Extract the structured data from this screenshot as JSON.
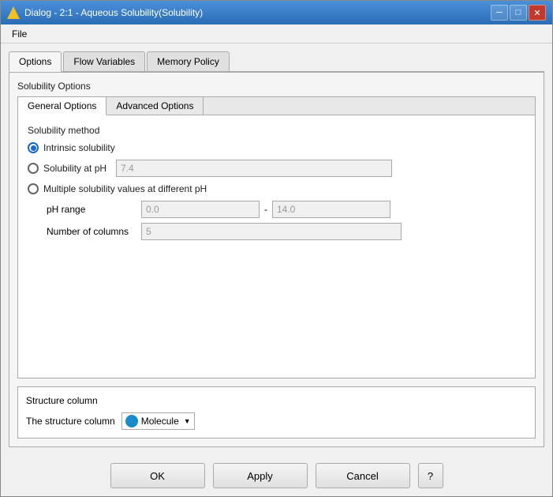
{
  "window": {
    "title": "Dialog - 2:1 - Aqueous Solubility(Solubility)",
    "icon": "warning-icon"
  },
  "title_controls": {
    "minimize": "─",
    "maximize": "□",
    "close": "✕"
  },
  "menu": {
    "file_label": "File"
  },
  "tabs": [
    {
      "label": "Options",
      "active": true
    },
    {
      "label": "Flow Variables",
      "active": false
    },
    {
      "label": "Memory Policy",
      "active": false
    }
  ],
  "main_section": {
    "label": "Solubility Options",
    "inner_tabs": [
      {
        "label": "General Options",
        "active": true
      },
      {
        "label": "Advanced Options",
        "active": false
      }
    ],
    "solubility_method_label": "Solubility method",
    "radio_options": [
      {
        "label": "Intrinsic solubility",
        "checked": true,
        "id": "intrinsic"
      },
      {
        "label": "Solubility at pH",
        "checked": false,
        "id": "at_ph"
      },
      {
        "label": "Multiple solubility values at different pH",
        "checked": false,
        "id": "multiple_ph"
      }
    ],
    "ph_input_value": "7.4",
    "ph_range_label": "pH range",
    "ph_range_from": "0.0",
    "ph_range_sep": "-",
    "ph_range_to": "14.0",
    "columns_label": "Number of columns",
    "columns_value": "5"
  },
  "structure_section": {
    "label": "Structure column",
    "row_text": "The structure column",
    "dropdown_text": "Molecule",
    "dropdown_icon": "molecule-icon"
  },
  "buttons": {
    "ok_label": "OK",
    "apply_label": "Apply",
    "cancel_label": "Cancel",
    "help_label": "?"
  }
}
